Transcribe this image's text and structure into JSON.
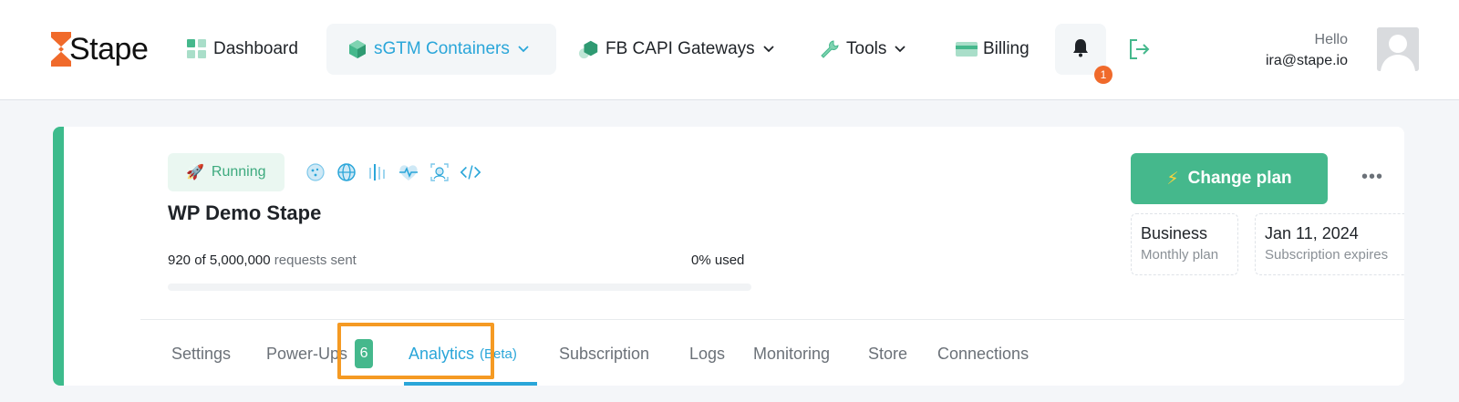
{
  "header": {
    "logo_text": "Stape",
    "nav": {
      "dashboard": "Dashboard",
      "containers": "sGTM Containers",
      "fb_capi": "FB CAPI Gateways",
      "tools": "Tools",
      "billing": "Billing"
    },
    "notifications_count": "1",
    "user": {
      "greeting": "Hello",
      "email": "ira@stape.io"
    }
  },
  "container": {
    "status": "Running",
    "name": "WP Demo Stape",
    "requests_used": "920 of 5,000,000",
    "requests_label": "requests sent",
    "percent_used_label": "0% used",
    "percent_used": 0,
    "feature_icons": [
      "cookie-icon",
      "globe-icon",
      "bars-icon",
      "heartbeat-icon",
      "face-scan-icon",
      "code-icon"
    ]
  },
  "plan": {
    "change_button": "Change plan",
    "name": "Business",
    "period": "Monthly plan",
    "expiry_date": "Jan 11, 2024",
    "expiry_label": "Subscription expires"
  },
  "tabs": {
    "settings": "Settings",
    "powerups": "Power-Ups",
    "powerups_count": "6",
    "analytics": "Analytics",
    "analytics_tag": "(Beta)",
    "subscription": "Subscription",
    "logs": "Logs",
    "monitoring": "Monitoring",
    "store": "Store",
    "connections": "Connections"
  },
  "colors": {
    "brand_orange": "#f06a2b",
    "accent_blue": "#2aa6d9",
    "accent_green": "#45b88c",
    "highlight": "#f59a23"
  }
}
